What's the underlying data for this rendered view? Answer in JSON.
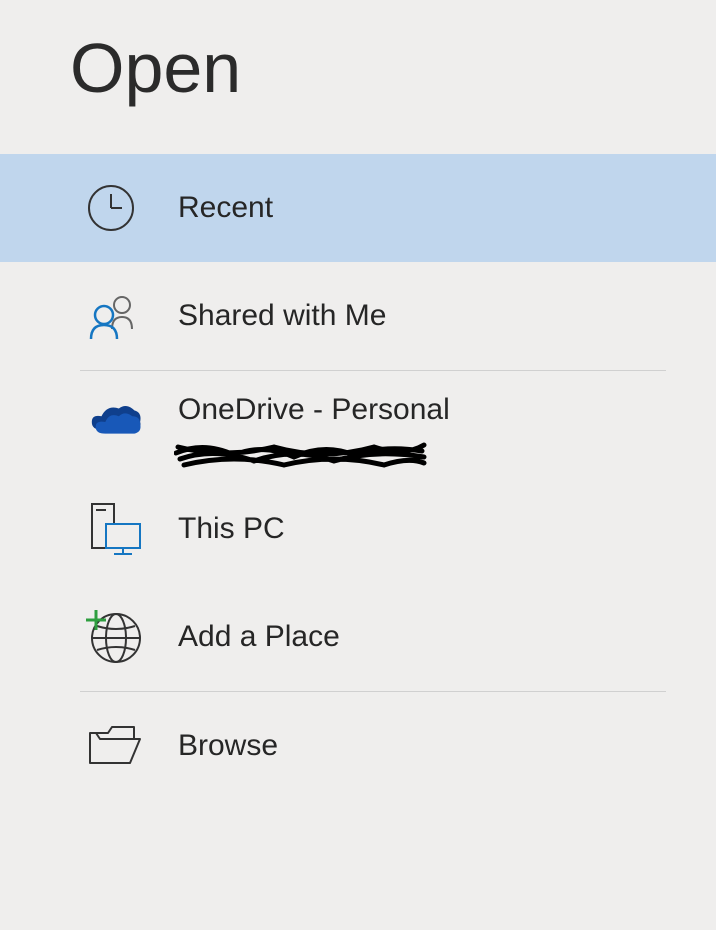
{
  "title": "Open",
  "menu": {
    "recent": {
      "label": "Recent"
    },
    "shared": {
      "label": "Shared with Me"
    },
    "onedrive": {
      "label": "OneDrive - Personal"
    },
    "thispc": {
      "label": "This PC"
    },
    "addplace": {
      "label": "Add a Place"
    },
    "browse": {
      "label": "Browse"
    }
  },
  "colors": {
    "selected_bg": "#c0d6ed",
    "accent_blue": "#1576c2",
    "onedrive_blue": "#0f3f8c"
  }
}
